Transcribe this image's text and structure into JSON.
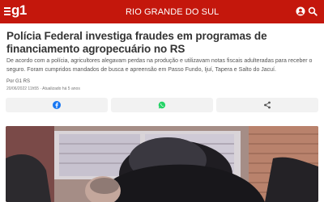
{
  "header": {
    "logo": "g1",
    "section": "RIO GRANDE DO SUL",
    "menu_icon": "hamburger-menu-icon",
    "user_icon": "user-icon",
    "search_icon": "search-icon",
    "bg_color": "#c4170c"
  },
  "article": {
    "headline": "Polícia Federal investiga fraudes em programas de financiamento agropecuário no RS",
    "lead": "De acordo com a polícia, agricultores alegavam perdas na produção e utilizavam notas fiscais adulteradas para receber o seguro. Foram cumpridos mandados de busca e apreensão em Passo Fundo, Ijuí, Tapera e Salto do Jacuí.",
    "byline": "Por G1 RS",
    "date": "20/06/2022 11h55 · Atualizado há 5 anos"
  },
  "share": {
    "facebook_icon": "facebook-icon",
    "whatsapp_icon": "whatsapp-icon",
    "share_icon": "share-icon",
    "facebook_color": "#1877f2",
    "whatsapp_color": "#25d366"
  },
  "photo": {
    "description_icon": "article-photo"
  }
}
